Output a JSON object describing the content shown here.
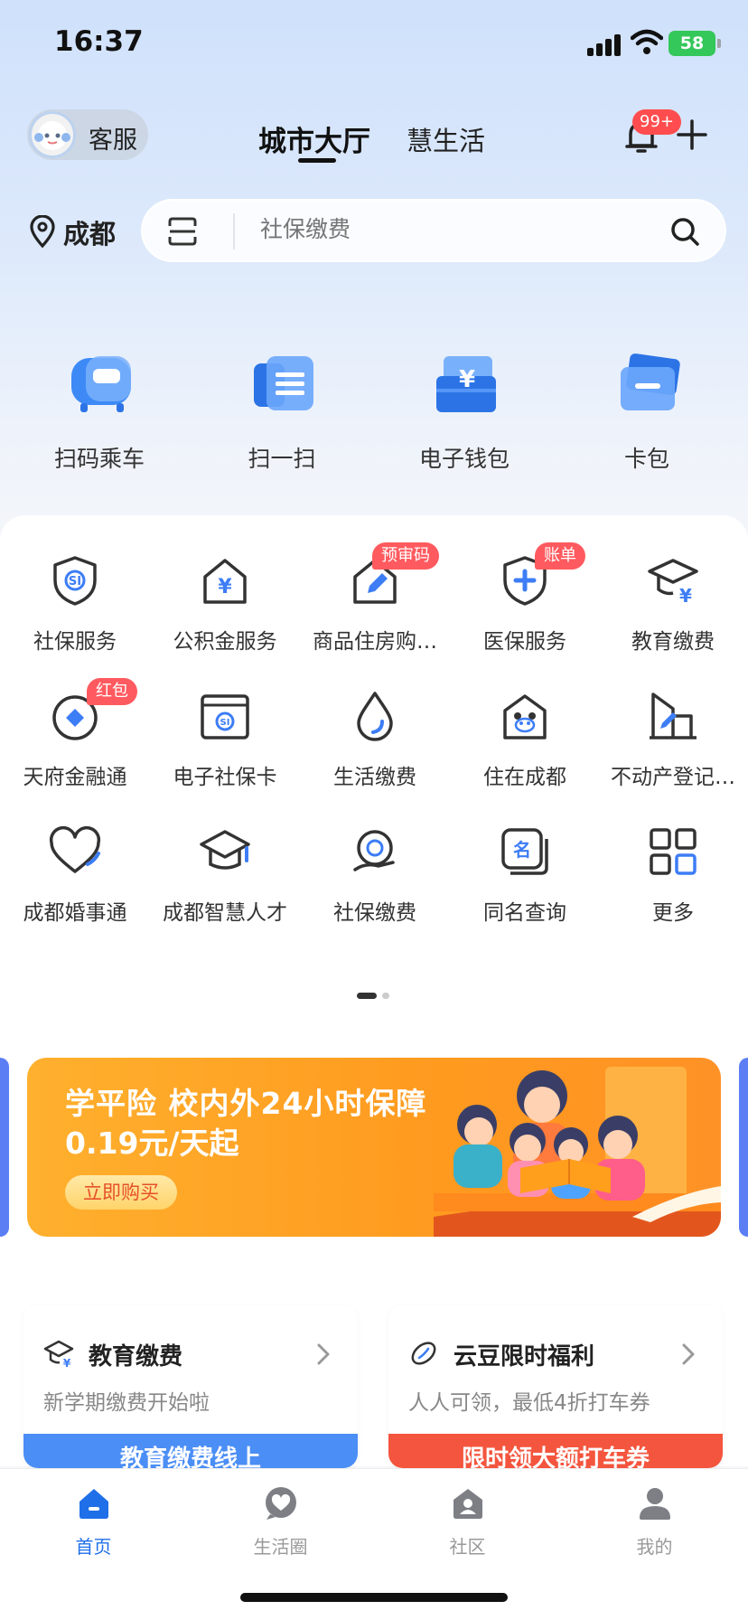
{
  "status_bar": {
    "time": "16:37",
    "battery": "58"
  },
  "header": {
    "customer_service": "客服",
    "tabs": [
      {
        "label": "城市大厅",
        "active": true
      },
      {
        "label": "慧生活",
        "active": false
      }
    ],
    "notification_badge": "99+"
  },
  "location": {
    "city": "成都"
  },
  "search": {
    "placeholder": "社保缴费"
  },
  "quick_actions": [
    {
      "label": "扫码乘车",
      "icon": "bus-icon"
    },
    {
      "label": "扫一扫",
      "icon": "scan-icon"
    },
    {
      "label": "电子钱包",
      "icon": "wallet-icon"
    },
    {
      "label": "卡包",
      "icon": "card-icon"
    }
  ],
  "services": [
    {
      "label": "社保服务",
      "icon": "social-security-shield-icon",
      "badge": ""
    },
    {
      "label": "公积金服务",
      "icon": "housing-fund-icon",
      "badge": ""
    },
    {
      "label": "商品住房购…",
      "icon": "house-edit-icon",
      "badge": "预审码"
    },
    {
      "label": "医保服务",
      "icon": "medical-shield-icon",
      "badge": "账单"
    },
    {
      "label": "教育缴费",
      "icon": "education-cap-icon",
      "badge": ""
    },
    {
      "label": "天府金融通",
      "icon": "finance-diamond-icon",
      "badge": "红包"
    },
    {
      "label": "电子社保卡",
      "icon": "social-card-icon",
      "badge": ""
    },
    {
      "label": "生活缴费",
      "icon": "water-drop-icon",
      "badge": ""
    },
    {
      "label": "住在成都",
      "icon": "panda-house-icon",
      "badge": ""
    },
    {
      "label": "不动产登记…",
      "icon": "building-edit-icon",
      "badge": ""
    },
    {
      "label": "成都婚事通",
      "icon": "heart-icon",
      "badge": ""
    },
    {
      "label": "成都智慧人才",
      "icon": "graduation-cap-icon",
      "badge": ""
    },
    {
      "label": "社保缴费",
      "icon": "social-pay-icon",
      "badge": ""
    },
    {
      "label": "同名查询",
      "icon": "name-query-icon",
      "badge": ""
    },
    {
      "label": "更多",
      "icon": "grid-more-icon",
      "badge": ""
    }
  ],
  "banner": {
    "title": "学平险 校内外24小时保障",
    "subtitle": "0.19元/天起",
    "button": "立即购买"
  },
  "cards": [
    {
      "title": "教育缴费",
      "subtitle": "新学期缴费开始啦",
      "strip": "教育缴费线上",
      "strip_color": "#4b8ef5"
    },
    {
      "title": "云豆限时福利",
      "subtitle": "人人可领，最低4折打车券",
      "strip": "限时领大额打车券",
      "strip_color": "#f4553e"
    }
  ],
  "tabbar": [
    {
      "label": "首页",
      "active": true,
      "icon": "home-icon"
    },
    {
      "label": "生活圈",
      "active": false,
      "icon": "heart-chat-icon"
    },
    {
      "label": "社区",
      "active": false,
      "icon": "community-icon"
    },
    {
      "label": "我的",
      "active": false,
      "icon": "user-icon"
    }
  ],
  "colors": {
    "accent": "#1f6fe8",
    "badge": "#ff4d4f",
    "icon_blue": "#3d7df5"
  }
}
